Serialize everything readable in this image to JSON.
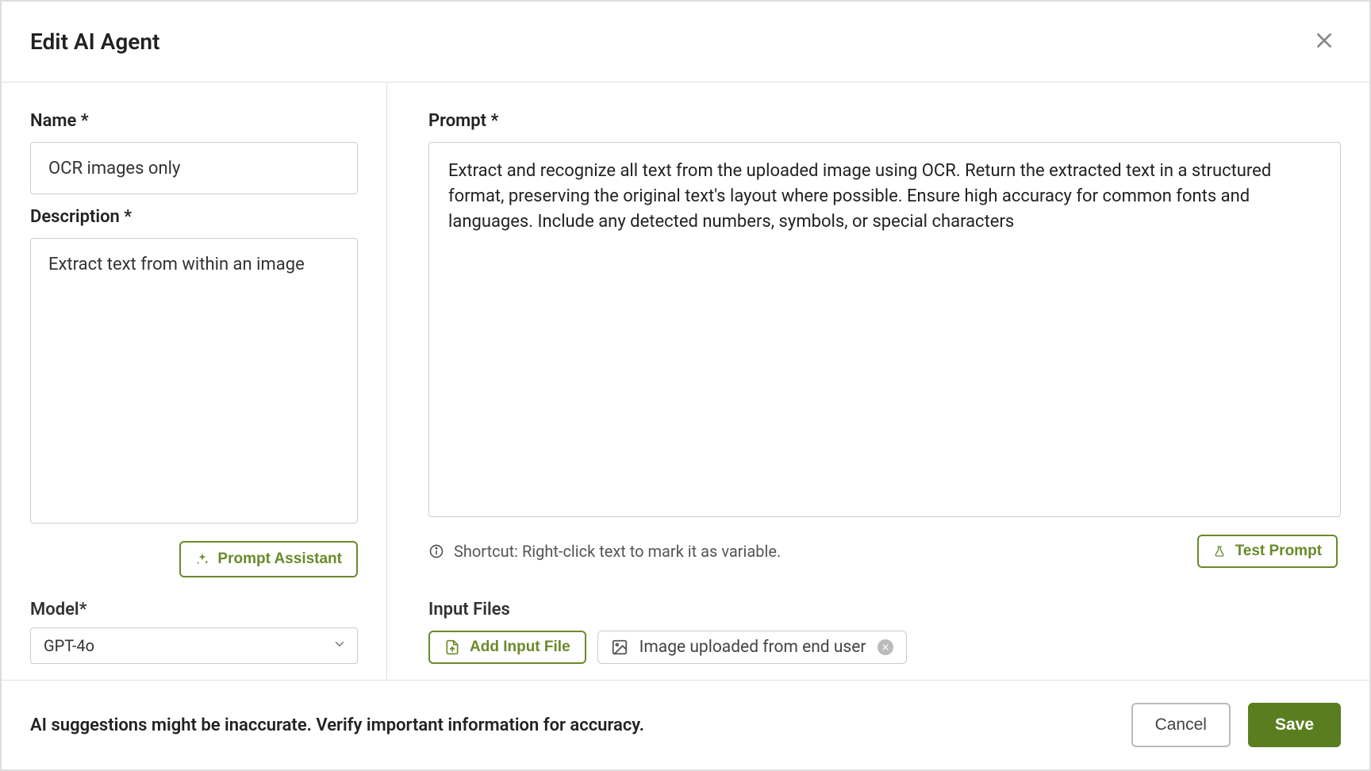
{
  "modal": {
    "title": "Edit AI Agent"
  },
  "left": {
    "name_label": "Name *",
    "name_value": "OCR images only",
    "description_label": "Description *",
    "description_value": "Extract text from within an image",
    "prompt_assistant_label": "Prompt Assistant",
    "model_label": "Model*",
    "model_value": "GPT-4o"
  },
  "right": {
    "prompt_label": "Prompt *",
    "prompt_value": "Extract and recognize all text from the uploaded image using OCR. Return the extracted text in a structured format, preserving the original text's layout where possible. Ensure high accuracy for common fonts and languages. Include any detected numbers, symbols, or special characters",
    "shortcut_hint": "Shortcut: Right-click text to mark it as variable.",
    "test_prompt_label": "Test Prompt",
    "input_files_heading": "Input Files",
    "add_input_file_label": "Add Input File",
    "file_chip_label": "Image uploaded from end user"
  },
  "footer": {
    "warning": "AI suggestions might be inaccurate. Verify important information for accuracy.",
    "cancel_label": "Cancel",
    "save_label": "Save"
  }
}
